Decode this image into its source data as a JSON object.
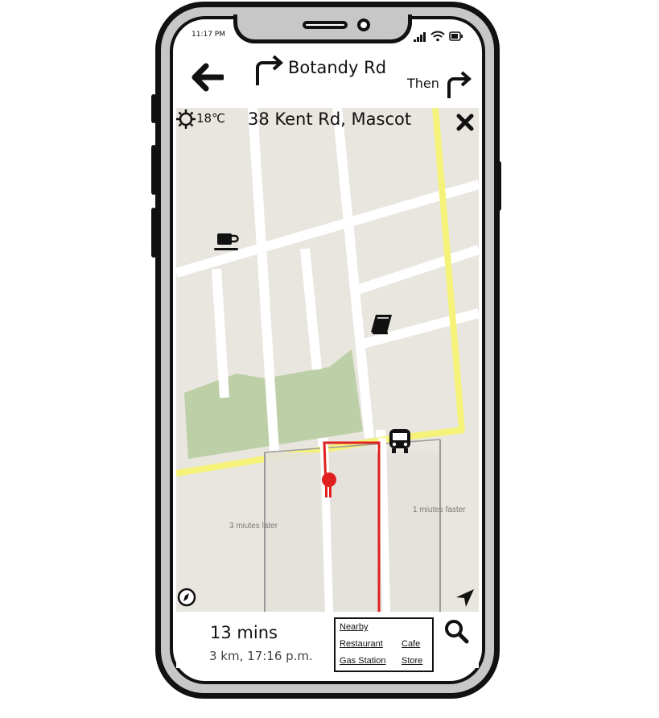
{
  "status_bar": {
    "time": "11:17 PM"
  },
  "navigation": {
    "back_icon": "arrow-left-icon",
    "current_turn_icon": "turn-right-arrow-icon",
    "current_street": "Botandy Rd",
    "next_label": "Then",
    "next_turn_icon": "turn-right-arrow-icon"
  },
  "weather": {
    "icon": "sun-icon",
    "temperature": "18℃"
  },
  "destination": {
    "address": "38 Kent Rd, Mascot",
    "close_icon": "close-icon"
  },
  "map": {
    "poi_icons": [
      "coffee-cup-icon",
      "book-icon",
      "bus-icon"
    ],
    "pin_icon": "map-pin-icon",
    "alternative_routes": [
      "3 miutes later",
      "1 miutes faster"
    ],
    "compass_icon": "compass-icon",
    "locate_icon": "navigation-arrow-icon",
    "colors": {
      "park": "#bccfa6",
      "highway": "#f5f27a",
      "route": "#e02020",
      "land": "#e9e6df"
    }
  },
  "trip": {
    "duration": "13 mins",
    "details": "3 km, 17:16 p.m."
  },
  "nearby": {
    "title": "Nearby",
    "items": [
      "Restaurant",
      "Cafe",
      "Gas Station",
      "Store"
    ]
  },
  "search": {
    "icon": "search-icon"
  }
}
